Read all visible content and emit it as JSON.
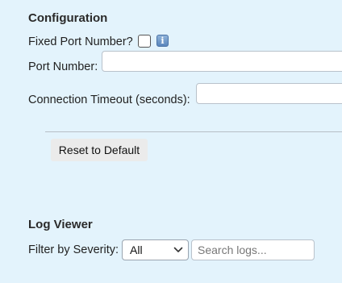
{
  "configuration": {
    "title": "Configuration",
    "fixed_port_label": "Fixed Port Number?",
    "fixed_port_checked": false,
    "info_icon": "info-icon",
    "port_number_label": "Port Number:",
    "port_number_value": "",
    "timeout_label": "Connection Timeout (seconds):",
    "timeout_value": "",
    "reset_label": "Reset to Default"
  },
  "log_viewer": {
    "title": "Log Viewer",
    "filter_label": "Filter by Severity:",
    "severity_selected": "All",
    "search_placeholder": "Search logs..."
  },
  "colors": {
    "background": "#e3f3fc",
    "input_border": "#b9c2cb",
    "button_bg": "#ebebeb"
  }
}
